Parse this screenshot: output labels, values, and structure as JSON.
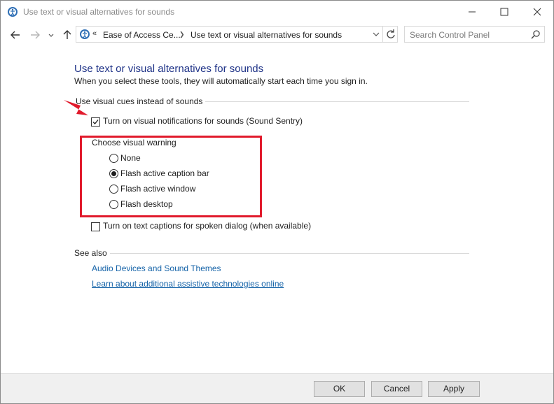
{
  "window": {
    "title": "Use text or visual alternatives for sounds",
    "controls": [
      "minimize",
      "maximize",
      "close"
    ]
  },
  "navigation": {
    "back": "back-arrow-icon",
    "forward": "forward-arrow-icon",
    "recent": "chevron-down-icon",
    "up": "up-arrow-icon",
    "address": {
      "overflow": "«",
      "crumbs": [
        "Ease of Access Ce...",
        "Use text or visual alternatives for sounds"
      ]
    },
    "search_placeholder": "Search Control Panel"
  },
  "main": {
    "heading": "Use text or visual alternatives for sounds",
    "subtitle": "When you select these tools, they will automatically start each time you sign in.",
    "visual_cues": {
      "group_label": "Use visual cues instead of sounds",
      "sound_sentry": {
        "label": "Turn on visual notifications for sounds (Sound Sentry)",
        "checked": true
      },
      "warning_label": "Choose visual warning",
      "options": [
        {
          "label": "None",
          "selected": false
        },
        {
          "label": "Flash active caption bar",
          "selected": true
        },
        {
          "label": "Flash active window",
          "selected": false
        },
        {
          "label": "Flash desktop",
          "selected": false
        }
      ],
      "text_captions": {
        "label": "Turn on text captions for spoken dialog (when available)",
        "checked": false
      }
    },
    "see_also": {
      "label": "See also",
      "links": [
        "Audio Devices and Sound Themes",
        "Learn about additional assistive technologies online"
      ]
    }
  },
  "buttons": {
    "ok": "OK",
    "cancel": "Cancel",
    "apply": "Apply"
  },
  "colors": {
    "heading": "#1e3287",
    "link": "#1563a8",
    "annotation": "#e11a2c"
  }
}
